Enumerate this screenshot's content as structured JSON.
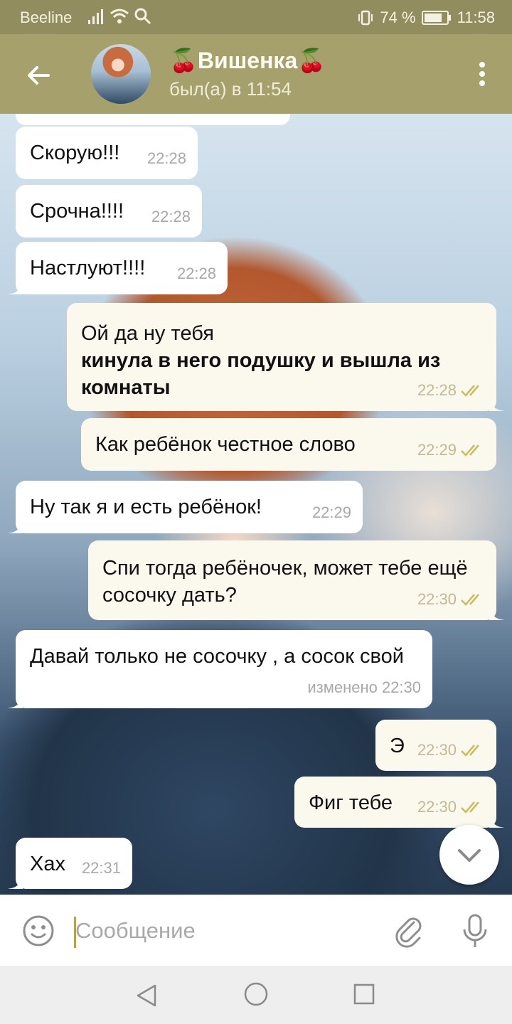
{
  "status_bar": {
    "carrier": "Beeline",
    "battery_text": "74 %",
    "time": "11:58"
  },
  "header": {
    "contact_name": "🍒Вишенка🍒",
    "last_seen": "был(а) в 11:54"
  },
  "messages": [
    {
      "text": "Скорую!!!",
      "time": "22:28",
      "direction": "in"
    },
    {
      "text": "Срочна!!!!",
      "time": "22:28",
      "direction": "in"
    },
    {
      "text": "Настлуют!!!!",
      "time": "22:28",
      "direction": "in"
    },
    {
      "text": "Ой да ну тебя",
      "text_bold": "кинула в него подушку и вышла из комнаты",
      "time": "22:28",
      "direction": "out",
      "read": true
    },
    {
      "text": "Как ребёнок честное слово",
      "time": "22:29",
      "direction": "out",
      "read": true
    },
    {
      "text": "Ну так я и есть ребёнок!",
      "time": "22:29",
      "direction": "in"
    },
    {
      "text": "Спи тогда ребёночек, может тебе ещё сосочку дать?",
      "time": "22:30",
      "direction": "out",
      "read": true
    },
    {
      "text": "Давай только не сосочку , а сосок свой",
      "time": "изменено 22:30",
      "direction": "in"
    },
    {
      "text": "Э",
      "time": "22:30",
      "direction": "out",
      "read": true
    },
    {
      "text": "Фиг тебе",
      "time": "22:30",
      "direction": "out",
      "read": true
    },
    {
      "text": "Хах",
      "time": "22:31",
      "direction": "in"
    }
  ],
  "input": {
    "placeholder": "Сообщение",
    "value": ""
  },
  "colors": {
    "header": "#a5a06c",
    "status_bar": "#928d5e",
    "incoming_bubble": "#ffffff",
    "outgoing_bubble": "#fbf8ee",
    "read_check": "#c9bd62"
  },
  "icons": {
    "back": "arrow-left-icon",
    "menu": "more-vertical-icon",
    "emoji": "smile-icon",
    "attach": "paperclip-icon",
    "mic": "microphone-icon",
    "scroll_down": "chevron-down-icon"
  }
}
